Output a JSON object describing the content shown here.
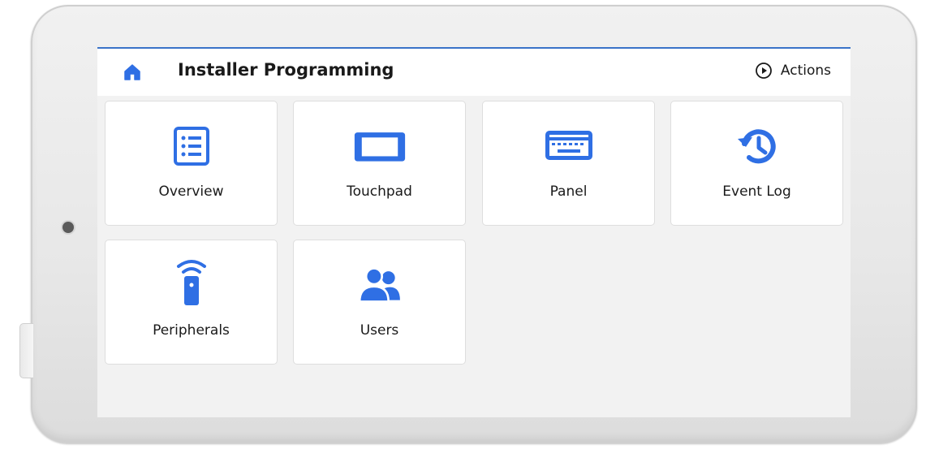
{
  "header": {
    "title": "Installer Programming",
    "actions_label": "Actions"
  },
  "tiles": [
    {
      "label": "Overview",
      "icon": "list-icon"
    },
    {
      "label": "Touchpad",
      "icon": "tablet-icon"
    },
    {
      "label": "Panel",
      "icon": "keypad-icon"
    },
    {
      "label": "Event Log",
      "icon": "history-icon"
    },
    {
      "label": "Peripherals",
      "icon": "wireless-device-icon"
    },
    {
      "label": "Users",
      "icon": "users-icon"
    }
  ],
  "colors": {
    "accent": "#2f6fe4",
    "tile_bg": "#ffffff",
    "screen_bg": "#f2f2f2",
    "appbar_bg": "#ffffff",
    "text": "#1a1a1a"
  }
}
